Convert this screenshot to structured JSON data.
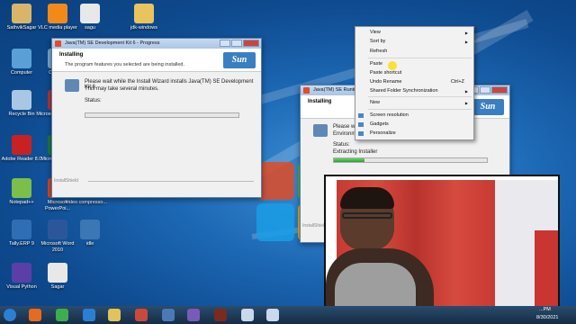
{
  "desktop_icons": [
    {
      "label": "SathvikSagar",
      "icon": "user-folder-icon",
      "color": "#d9b56a"
    },
    {
      "label": "VLC media player",
      "icon": "vlc-icon",
      "color": "#f28a1a"
    },
    {
      "label": "sagu",
      "icon": "file-icon",
      "color": "#e8e8e8"
    },
    {
      "label": "jdk-windows",
      "icon": "folder-icon",
      "color": "#e9c35d"
    },
    {
      "label": "Computer",
      "icon": "computer-icon",
      "color": "#5aa0d6"
    },
    {
      "label": "Calcul...",
      "icon": "calculator-icon",
      "color": "#7aa6c9"
    },
    {
      "label": "Recycle Bin",
      "icon": "recycle-bin-icon",
      "color": "#a9c7e4"
    },
    {
      "label": "Microsoft Access ...",
      "icon": "access-icon",
      "color": "#b53333"
    },
    {
      "label": "Adobe Reader 8.0",
      "icon": "adobe-reader-icon",
      "color": "#c92121"
    },
    {
      "label": "Microsoft Excel 20...",
      "icon": "excel-icon",
      "color": "#1d7a3c"
    },
    {
      "label": "Notepad++",
      "icon": "notepad-plus-icon",
      "color": "#7bbf4a"
    },
    {
      "label": "Microsoft PowerPoi...",
      "icon": "powerpoint-icon",
      "color": "#d24726"
    },
    {
      "label": "video compresso...",
      "icon": "video-file-icon",
      "color": "#e8e8e8"
    },
    {
      "label": "Tally.ERP 9",
      "icon": "tally-icon",
      "color": "#2f6db5"
    },
    {
      "label": "Microsoft Word 2010",
      "icon": "word-icon",
      "color": "#2b579a"
    },
    {
      "label": "idle",
      "icon": "python-idle-icon",
      "color": "#3b77b5"
    },
    {
      "label": "Visual Python",
      "icon": "visual-python-icon",
      "color": "#5a3fa8"
    },
    {
      "label": "Sagar",
      "icon": "file-icon",
      "color": "#e8e8e8"
    }
  ],
  "window1": {
    "title": "Java(TM) SE Development Kit 6 - Progress",
    "heading": "Installing",
    "subheading": "The program features you selected are being installed.",
    "message_line1": "Please wait while the Install Wizard installs Java(TM) SE Development Kit 6.",
    "message_line2": "This may take several minutes.",
    "status_label": "Status:",
    "footer": "InstallShield",
    "progress": 0.0,
    "brand": "Sun"
  },
  "window2": {
    "title": "Java(TM) SE Runtim...",
    "heading": "Installing",
    "message_line1": "Please wait...",
    "message_line2": "Environme...",
    "status_label": "Status:",
    "status_value": "Extracting Installer",
    "footer": "InstallShield",
    "progress": 0.2,
    "brand": "Sun"
  },
  "context_menu": {
    "items": [
      {
        "label": "View",
        "submenu": true
      },
      {
        "label": "Sort by",
        "submenu": true
      },
      {
        "label": "Refresh"
      },
      {
        "label": "Paste"
      },
      {
        "label": "Paste shortcut"
      },
      {
        "label": "Undo Rename",
        "shortcut": "Ctrl+Z"
      },
      {
        "label": "Shared Folder Synchronization",
        "submenu": true
      },
      {
        "label": "New",
        "submenu": true
      },
      {
        "label": "Screen resolution"
      },
      {
        "label": "Gadgets"
      },
      {
        "label": "Personalize"
      }
    ]
  },
  "taskbar": {
    "time": "...PM",
    "date": "8/30/2021",
    "items": [
      "start-orb-icon",
      "firefox-icon",
      "chrome-icon",
      "ie-icon",
      "explorer-folder-icon",
      "paint-icon",
      "network-icon",
      "media-icon",
      "terminal-icon",
      "java-installer-icon",
      "java-installer-icon"
    ]
  }
}
